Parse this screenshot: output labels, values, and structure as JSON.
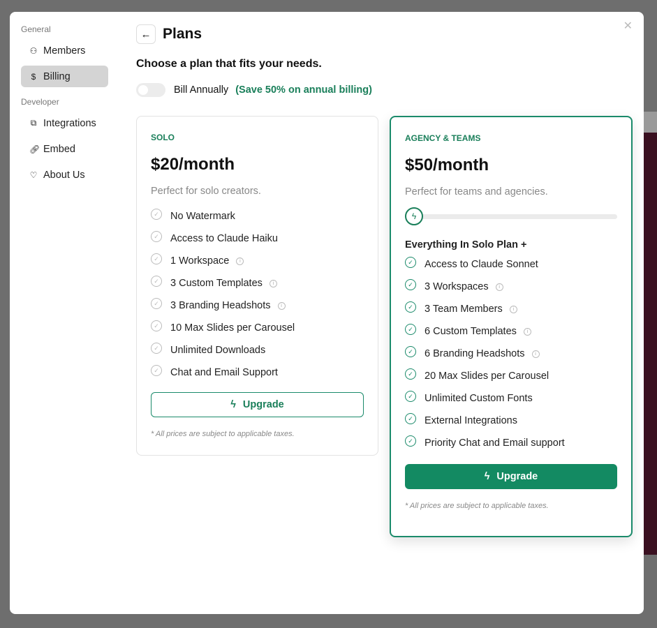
{
  "sidebar": {
    "general_label": "General",
    "developer_label": "Developer",
    "items": [
      {
        "label": "Members",
        "icon": "users-icon"
      },
      {
        "label": "Billing",
        "icon": "dollar-circle-icon"
      }
    ],
    "dev_items": [
      {
        "label": "Integrations",
        "icon": "copy-icon"
      },
      {
        "label": "Embed",
        "icon": "link-icon"
      },
      {
        "label": "About Us",
        "icon": "heart-icon"
      }
    ]
  },
  "header": {
    "title": "Plans",
    "subtitle": "Choose a plan that fits your needs."
  },
  "billing": {
    "toggle_label": "Bill Annually",
    "save_note": "(Save 50% on annual billing)",
    "annual_on": false
  },
  "plans": [
    {
      "name": "SOLO",
      "price": "$20/month",
      "desc": "Perfect for solo creators.",
      "features": [
        "No Watermark",
        "Access to Claude Haiku",
        "1 Workspace",
        "3 Custom Templates",
        "3 Branding Headshots",
        "10 Max Slides per Carousel",
        "Unlimited Downloads",
        "Chat and Email Support"
      ],
      "button": "Upgrade",
      "tax": "* All prices are subject to applicable taxes."
    },
    {
      "name": "AGENCY & TEAMS",
      "price": "$50/month",
      "desc": "Perfect for teams and agencies.",
      "slider_level": 0,
      "includes": "Everything In Solo Plan +",
      "features": [
        "Access to Claude Sonnet",
        "3 Workspaces",
        "3 Team Members",
        "6 Custom Templates",
        "6 Branding Headshots",
        "20 Max Slides per Carousel",
        "Unlimited Custom Fonts",
        "External Integrations",
        "Priority Chat and Email support"
      ],
      "button": "Upgrade",
      "tax": "* All prices are subject to applicable taxes."
    }
  ],
  "colors": {
    "accent": "#138a62"
  }
}
